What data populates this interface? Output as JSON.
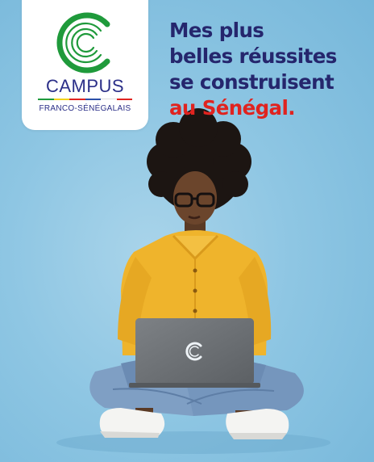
{
  "brand": {
    "name": "CAMPUS",
    "subtitle": "FRANCO-SÉNÉGALAIS",
    "logo_icon": "campus-c-logo-icon",
    "colors": {
      "green": "#1f9a3b",
      "navy": "#2b2f88",
      "flag_green": "#1e9a3d",
      "flag_yellow": "#f2d21a",
      "flag_red": "#e0231f",
      "flag_blue": "#2b4fa8"
    }
  },
  "headline": {
    "line1": "Mes plus",
    "line2": "belles réussites",
    "line3": "se construisent",
    "line4": "au Sénégal.",
    "color_dark": "#25266d",
    "color_accent": "#e0231f"
  },
  "photo": {
    "laptop_logo_icon": "campus-c-laptop-icon",
    "background": "#8ec6e3"
  }
}
